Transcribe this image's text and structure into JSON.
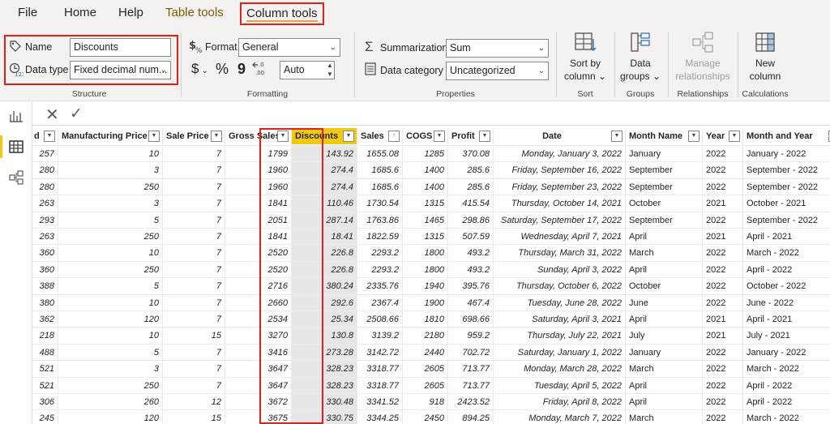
{
  "menu": {
    "file": "File",
    "home": "Home",
    "help": "Help",
    "table_tools": "Table tools",
    "column_tools": "Column tools"
  },
  "ribbon": {
    "structure": {
      "name_label": "Name",
      "name_value": "Discounts",
      "datatype_label": "Data type",
      "datatype_value": "Fixed decimal num...",
      "group_label": "Structure"
    },
    "formatting": {
      "format_label": "Format",
      "format_value": "General",
      "currency_symbol": "$",
      "percent_symbol": "%",
      "comma_symbol": "9",
      "decimals_value": "Auto",
      "group_label": "Formatting"
    },
    "properties": {
      "summarization_label": "Summarization",
      "summarization_value": "Sum",
      "datacategory_label": "Data category",
      "datacategory_value": "Uncategorized",
      "group_label": "Properties"
    },
    "sort": {
      "line1": "Sort by",
      "line2": "column",
      "group_label": "Sort"
    },
    "groups": {
      "line1": "Data",
      "line2": "groups",
      "group_label": "Groups"
    },
    "relationships": {
      "line1": "Manage",
      "line2": "relationships",
      "group_label": "Relationships"
    },
    "calculations": {
      "line1": "New",
      "line2": "column",
      "group_label": "Calculations"
    }
  },
  "table": {
    "headers": [
      "d",
      "Manufacturing Price",
      "Sale Price",
      "Gross Sales",
      "Discounts",
      "Sales",
      "COGS",
      "Profit",
      "Date",
      "Month Name",
      "Year",
      "Month and Year"
    ],
    "rows": [
      [
        "257",
        "10",
        "7",
        "1799",
        "143.92",
        "1655.08",
        "1285",
        "370.08",
        "Monday, January 3, 2022",
        "January",
        "2022",
        "January - 2022"
      ],
      [
        "280",
        "3",
        "7",
        "1960",
        "274.4",
        "1685.6",
        "1400",
        "285.6",
        "Friday, September 16, 2022",
        "September",
        "2022",
        "September - 2022"
      ],
      [
        "280",
        "250",
        "7",
        "1960",
        "274.4",
        "1685.6",
        "1400",
        "285.6",
        "Friday, September 23, 2022",
        "September",
        "2022",
        "September - 2022"
      ],
      [
        "263",
        "3",
        "7",
        "1841",
        "110.46",
        "1730.54",
        "1315",
        "415.54",
        "Thursday, October 14, 2021",
        "October",
        "2021",
        "October - 2021"
      ],
      [
        "293",
        "5",
        "7",
        "2051",
        "287.14",
        "1763.86",
        "1465",
        "298.86",
        "Saturday, September 17, 2022",
        "September",
        "2022",
        "September - 2022"
      ],
      [
        "263",
        "250",
        "7",
        "1841",
        "18.41",
        "1822.59",
        "1315",
        "507.59",
        "Wednesday, April 7, 2021",
        "April",
        "2021",
        "April - 2021"
      ],
      [
        "360",
        "10",
        "7",
        "2520",
        "226.8",
        "2293.2",
        "1800",
        "493.2",
        "Thursday, March 31, 2022",
        "March",
        "2022",
        "March - 2022"
      ],
      [
        "360",
        "250",
        "7",
        "2520",
        "226.8",
        "2293.2",
        "1800",
        "493.2",
        "Sunday, April 3, 2022",
        "April",
        "2022",
        "April - 2022"
      ],
      [
        "388",
        "5",
        "7",
        "2716",
        "380.24",
        "2335.76",
        "1940",
        "395.76",
        "Thursday, October 6, 2022",
        "October",
        "2022",
        "October - 2022"
      ],
      [
        "380",
        "10",
        "7",
        "2660",
        "292.6",
        "2367.4",
        "1900",
        "467.4",
        "Tuesday, June 28, 2022",
        "June",
        "2022",
        "June - 2022"
      ],
      [
        "362",
        "120",
        "7",
        "2534",
        "25.34",
        "2508.66",
        "1810",
        "698.66",
        "Saturday, April 3, 2021",
        "April",
        "2021",
        "April - 2021"
      ],
      [
        "218",
        "10",
        "15",
        "3270",
        "130.8",
        "3139.2",
        "2180",
        "959.2",
        "Thursday, July 22, 2021",
        "July",
        "2021",
        "July - 2021"
      ],
      [
        "488",
        "5",
        "7",
        "3416",
        "273.28",
        "3142.72",
        "2440",
        "702.72",
        "Saturday, January 1, 2022",
        "January",
        "2022",
        "January - 2022"
      ],
      [
        "521",
        "3",
        "7",
        "3647",
        "328.23",
        "3318.77",
        "2605",
        "713.77",
        "Monday, March 28, 2022",
        "March",
        "2022",
        "March - 2022"
      ],
      [
        "521",
        "250",
        "7",
        "3647",
        "328.23",
        "3318.77",
        "2605",
        "713.77",
        "Tuesday, April 5, 2022",
        "April",
        "2022",
        "April - 2022"
      ],
      [
        "306",
        "260",
        "12",
        "3672",
        "330.48",
        "3341.52",
        "918",
        "2423.52",
        "Friday, April 8, 2022",
        "April",
        "2022",
        "April - 2022"
      ],
      [
        "245",
        "120",
        "15",
        "3675",
        "330.75",
        "3344.25",
        "2450",
        "894.25",
        "Monday, March 7, 2022",
        "March",
        "2022",
        "March - 2022"
      ]
    ]
  },
  "colors": {
    "highlight_red": "#e0201b",
    "selected_header": "#f2c811",
    "contextual_tab": "#7a5a00"
  }
}
